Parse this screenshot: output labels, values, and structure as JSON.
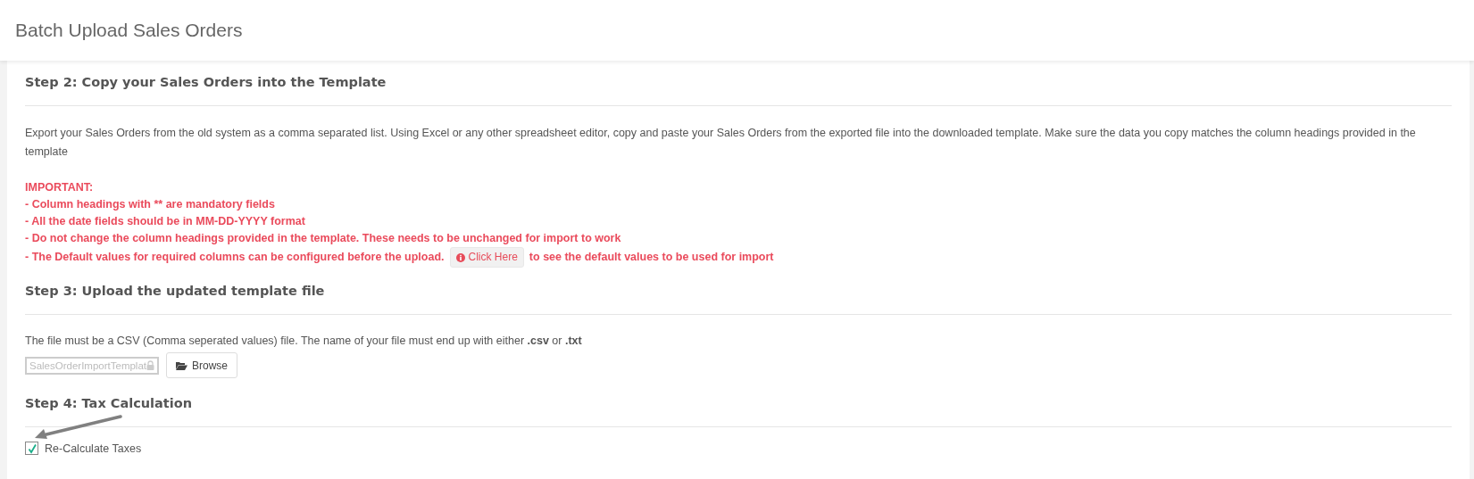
{
  "page_title": "Batch Upload Sales Orders",
  "step2": {
    "heading": "Step 2: Copy your Sales Orders into the Template",
    "paragraph": "Export your Sales Orders from the old system as a comma separated list. Using Excel or any other spreadsheet editor, copy and paste your Sales Orders from the exported file into the downloaded template. Make sure the data you copy matches the column headings provided in the template",
    "important_label": "IMPORTANT:",
    "rules": [
      "- Column headings with ** are mandatory fields",
      "- All the date fields should be in MM-DD-YYYY format",
      "- Do not change the column headings provided in the template. These needs to be unchanged for import to work"
    ],
    "default_note": {
      "before": "- The Default values for required columns can be configured before the upload.",
      "link": "Click Here",
      "after": "to see the default values to be used for import"
    }
  },
  "step3": {
    "heading": "Step 3: Upload the updated template file",
    "paragraph": "The file must be a CSV (Comma seperated values) file. The name of your file must end up with either **.csv** or **.txt**",
    "file_value": "SalesOrderImportTemplat",
    "browse_button": "Browse"
  },
  "step4": {
    "heading": "Step 4: Tax Calculation",
    "checkbox": {
      "label": "Re-Calculate Taxes",
      "checked": true
    }
  }
}
